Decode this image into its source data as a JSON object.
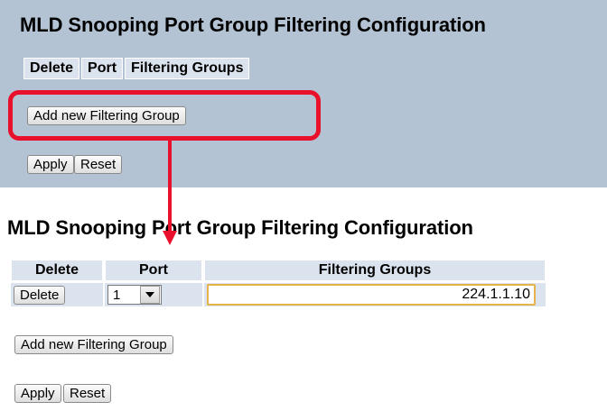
{
  "top": {
    "title": "MLD Snooping Port Group Filtering Configuration",
    "headers": [
      "Delete",
      "Port",
      "Filtering Groups"
    ],
    "add_button": "Add new Filtering Group",
    "apply_button": "Apply",
    "reset_button": "Reset"
  },
  "bottom": {
    "title": "MLD Snooping Port Group Filtering Configuration",
    "headers": [
      "Delete",
      "Port",
      "Filtering Groups"
    ],
    "row": {
      "delete_button": "Delete",
      "port_value": "1",
      "filtering_group_value": "224.1.1.10"
    },
    "add_button": "Add new Filtering Group",
    "apply_button": "Apply",
    "reset_button": "Reset"
  },
  "colors": {
    "panel_top_bg": "#b4c3d3",
    "header_bg": "#dbe4ee",
    "highlight": "#e8102a",
    "input_border": "#e6b24a"
  },
  "icons": {
    "select_arrow": "chevron-down-icon",
    "callout_arrow": "arrow-down-icon"
  }
}
